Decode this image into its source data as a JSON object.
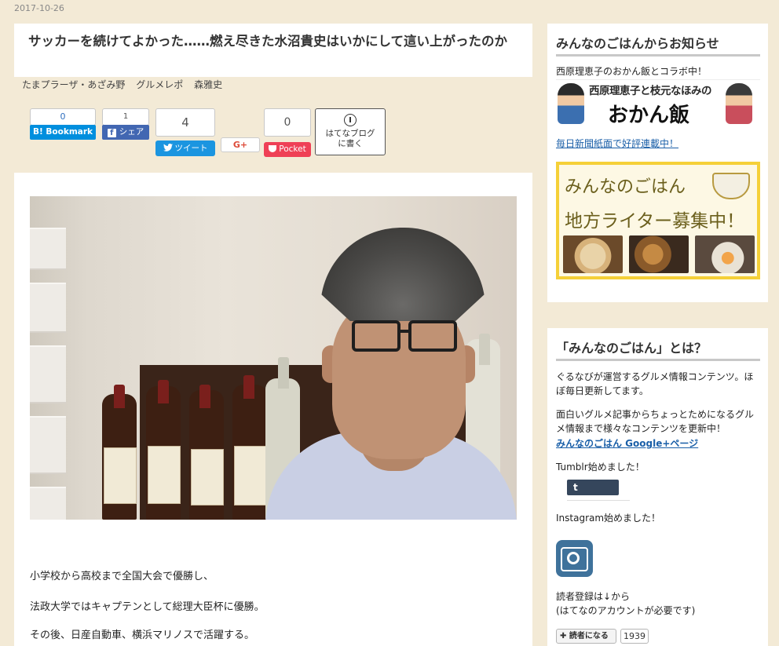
{
  "post": {
    "date": "2017-10-26",
    "title": "サッカーを続けてよかった……燃え尽きた水沼貴史はいかにして這い上がったのか",
    "categories": [
      "たまプラーザ・あざみ野",
      "グルメレポ",
      "森雅史"
    ]
  },
  "share": {
    "hatena_count": "0",
    "hatena_label": "Bookmark",
    "facebook_count": "1",
    "facebook_label": "シェア",
    "twitter_count": "4",
    "twitter_label": "ツイート",
    "gplus_label": "G+",
    "pocket_count": "0",
    "pocket_label": "Pocket",
    "hatena_blog_label_1": "はてなブログ",
    "hatena_blog_label_2": "に書く"
  },
  "article": {
    "paragraphs": [
      "小学校から高校まで全国大会で優勝し、",
      "法政大学ではキャプテンとして総理大臣杯に優勝。",
      "その後、日産自動車、横浜マリノスで活躍する。"
    ],
    "photo_icon": "portrait-photo"
  },
  "sidebar": {
    "notice_title": "みんなのごはんからお知らせ",
    "notice_collab": "西原理恵子のおかん飯とコラボ中！",
    "banner1_line1": "西原理恵子と枝元なほみの",
    "banner1_line2": "おかん飯",
    "notice_link": "毎日新聞紙面で好評連載中！",
    "banner2_line1": "みんなのごはん",
    "banner2_line2": "地方ライター募集中！",
    "about_title": "「みんなのごはん」とは？",
    "about_text1": "ぐるなびが運営するグルメ情報コンテンツ。ほぼ毎日更新してます。",
    "about_text2": "面白いグルメ記事からちょっとためになるグルメ情報まで様々なコンテンツを更新中！",
    "google_link": "みんなのごはん Google+ページ",
    "tumblr_text": "Tumblr始めました！",
    "tumblr_button": "t",
    "instagram_text": "Instagram始めました！",
    "reader_text1": "読者登録は↓から",
    "reader_text2": "(はてなのアカウントが必要です)",
    "reader_button": "✚ 読者になる",
    "reader_count": "1939"
  },
  "colors": {
    "background": "#f3ead6",
    "hatena_blue": "#008fde",
    "facebook_blue": "#4267b2",
    "twitter_blue": "#1b95e0",
    "pocket_red": "#ef4056",
    "banner_yellow": "#f5d038",
    "link_blue": "#1a5fa8"
  }
}
